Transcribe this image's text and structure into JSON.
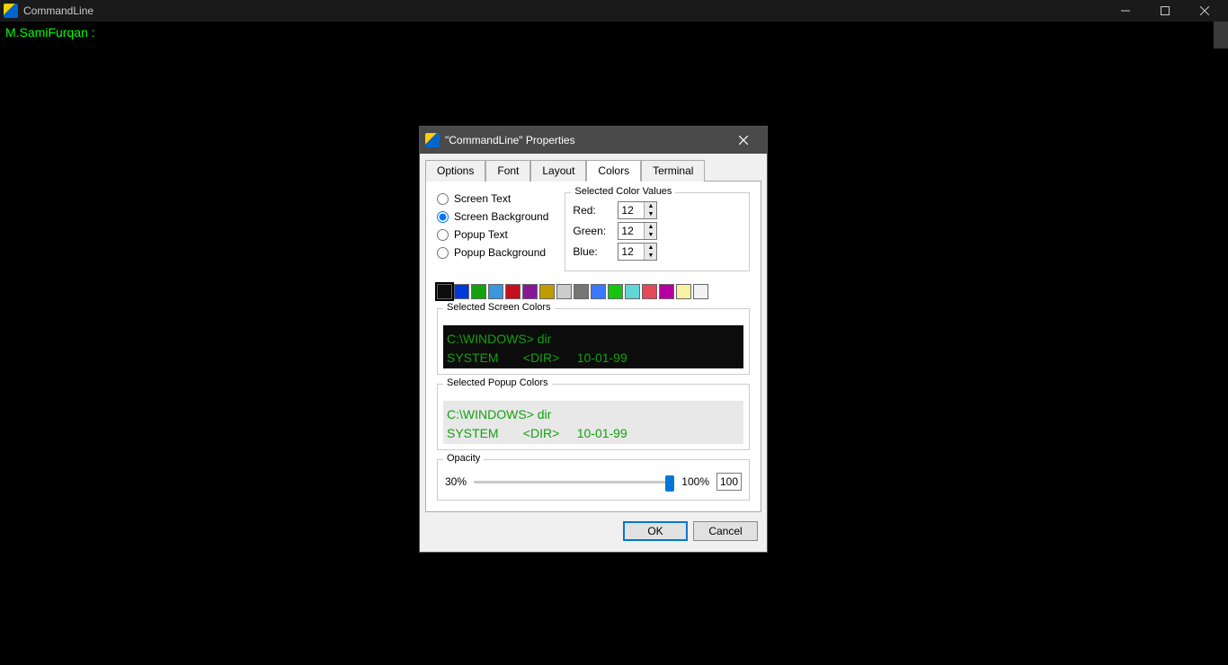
{
  "main_window": {
    "title": "CommandLine",
    "prompt": "M.SamiFurqan :"
  },
  "dialog": {
    "title": "\"CommandLine\" Properties",
    "tabs": [
      "Options",
      "Font",
      "Layout",
      "Colors",
      "Terminal"
    ],
    "active_tab": "Colors",
    "radios": {
      "screen_text": "Screen Text",
      "screen_background": "Screen Background",
      "popup_text": "Popup Text",
      "popup_background": "Popup Background",
      "selected": "Screen Background"
    },
    "scv": {
      "legend": "Selected Color Values",
      "red_label": "Red:",
      "green_label": "Green:",
      "blue_label": "Blue:",
      "red": "12",
      "green": "12",
      "blue": "12"
    },
    "palette": [
      "#0c0c0c",
      "#0037da",
      "#13a10e",
      "#3a96dd",
      "#c50f1f",
      "#881798",
      "#c19c00",
      "#cccccc",
      "#767676",
      "#3b78ff",
      "#16c60c",
      "#61d6d6",
      "#e74856",
      "#b4009e",
      "#f9f1a5",
      "#f2f2f2"
    ],
    "palette_selected_index": 0,
    "screen_preview": {
      "legend": "Selected Screen Colors",
      "line1": "C:\\WINDOWS> dir",
      "line2": "SYSTEM       <DIR>     10-01-99"
    },
    "popup_preview": {
      "legend": "Selected Popup Colors",
      "line1": "C:\\WINDOWS> dir",
      "line2": "SYSTEM       <DIR>     10-01-99"
    },
    "opacity": {
      "legend": "Opacity",
      "min_label": "30%",
      "max_label": "100%",
      "value": "100"
    },
    "buttons": {
      "ok": "OK",
      "cancel": "Cancel"
    }
  }
}
